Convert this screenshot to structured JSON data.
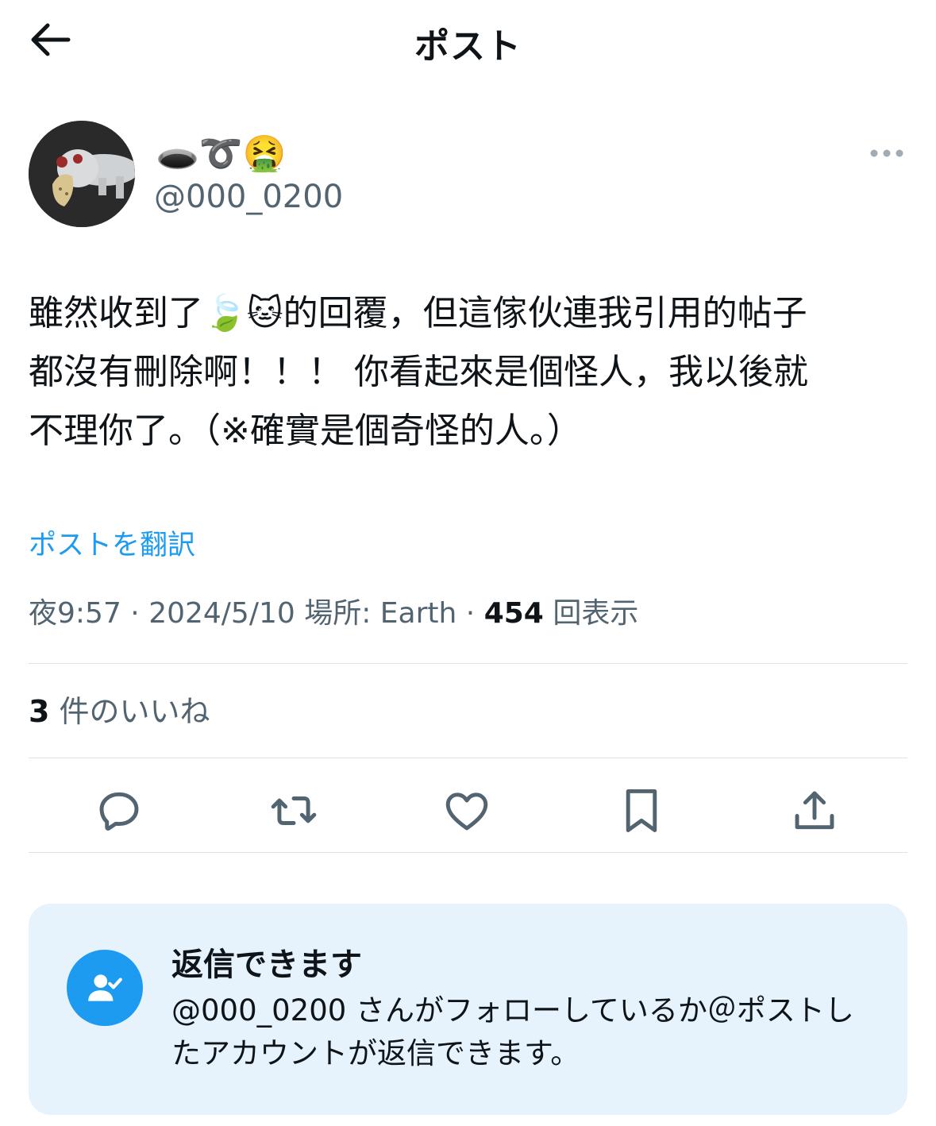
{
  "header": {
    "title": "ポスト"
  },
  "author": {
    "display_name": "🕳️➰🤮",
    "handle": "@000_0200"
  },
  "post": {
    "text": "雖然收到了🍃🐱的回覆，但這傢伙連我引用的帖子\n都沒有刪除啊！！！ 你看起來是個怪人，我以後就\n不理你了。（※確實是個奇怪的人。）",
    "translate_label": "ポストを翻訳"
  },
  "meta": {
    "time": "夜9:57",
    "separator": " · ",
    "date": "2024/5/10",
    "location": "場所: Earth",
    "views_count": "454",
    "views_label": "回表示"
  },
  "likes": {
    "count": "3",
    "label": "件のいいね"
  },
  "actions": {
    "icons": [
      "reply-icon",
      "repost-icon",
      "like-icon",
      "bookmark-icon",
      "share-icon"
    ]
  },
  "reply_settings": {
    "title": "返信できます",
    "description": "@000_0200 さんがフォローしているか＠ポストしたアカウントが返信できます。"
  },
  "colors": {
    "accent": "#1d9bf0",
    "text_secondary": "#536471",
    "card_background": "#e6f3fc",
    "divider": "#dfe3e7"
  }
}
